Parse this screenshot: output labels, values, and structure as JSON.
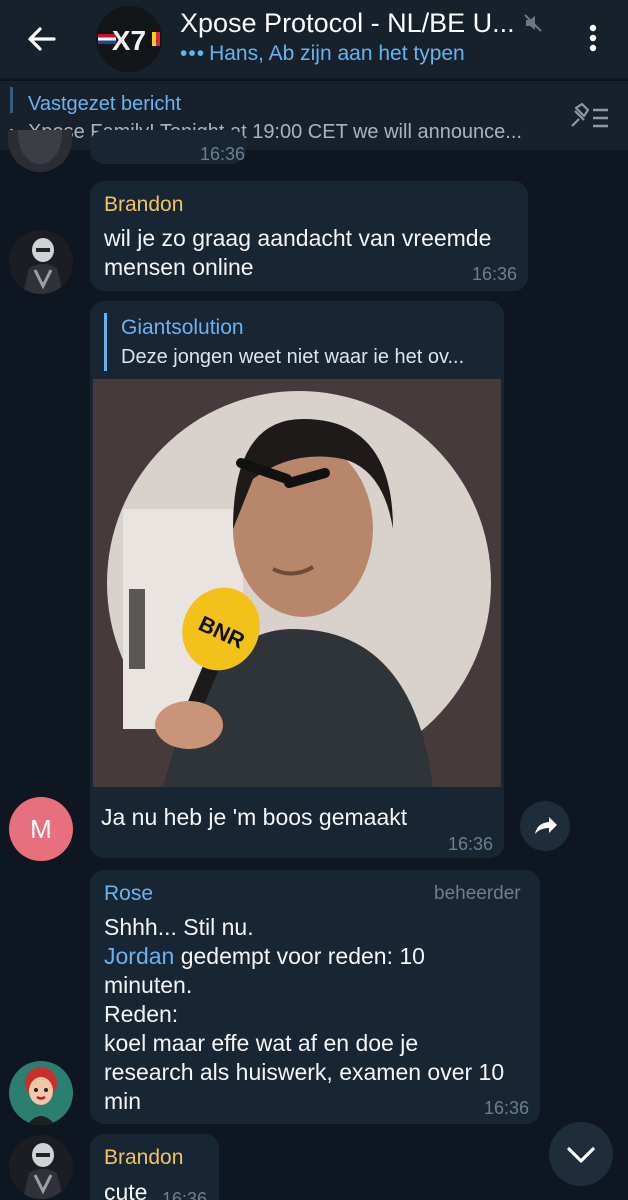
{
  "header": {
    "title": "Xpose Protocol - NL/BE U...",
    "typing_status": "Hans, Ab zijn aan het typen",
    "typing_dots": "•••",
    "channel_logo_text": "X7"
  },
  "pinned": {
    "label": "Vastgezet bericht",
    "text": "Xpose Family!  Tonight at 19:00 CET we will announce..."
  },
  "messages": [
    {
      "partial_time": "16:36"
    },
    {
      "sender": "Brandon",
      "sender_color": "#f0c462",
      "text_line1": "wil je zo graag aandacht van vreemde",
      "text_line2": "mensen online",
      "time": "16:36"
    },
    {
      "reply_to_sender": "Giantsolution",
      "reply_to_text": "Deze jongen weet niet waar ie het ov...",
      "photo_text": "BNR",
      "avatar_letter": "M",
      "avatar_color": "#e8707c",
      "text": "Ja nu heb je 'm boos gemaakt",
      "time": "16:36"
    },
    {
      "sender": "Rose",
      "sender_color": "#6ab3f3",
      "role": "beheerder",
      "line1": "Shhh... Stil nu.",
      "mention": "Jordan",
      "line2_rest": " gedempt voor reden: 10",
      "line3": "minuten.",
      "line4": "Reden:",
      "line5": "koel maar effe wat af en doe je",
      "line6": "research als huiswerk, examen over 10",
      "line7": "min",
      "time": "16:36"
    },
    {
      "sender": "Brandon",
      "sender_color": "#f0c462",
      "text": "cute",
      "time": "16:36"
    }
  ],
  "colors": {
    "background": "#0e1621",
    "header": "#17212b",
    "bubble": "#182533",
    "accent": "#6ab3f3"
  }
}
